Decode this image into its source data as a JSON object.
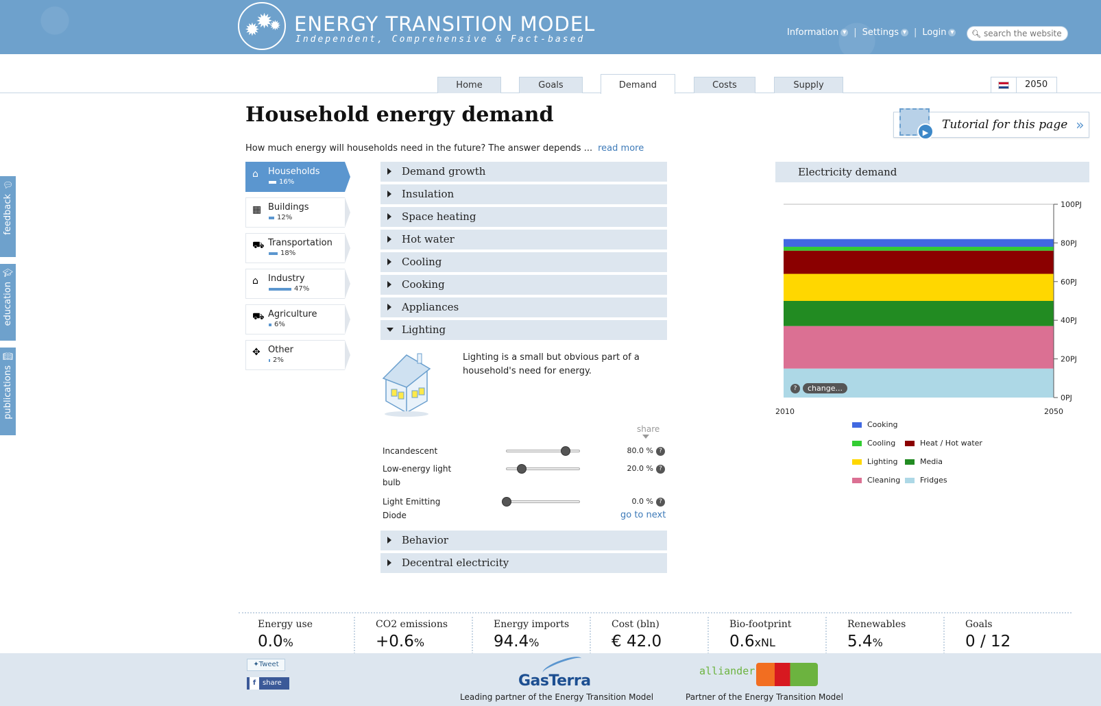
{
  "header": {
    "logo_title": "ENERGY TRANSITION MODEL",
    "logo_subtitle": "Independent, Comprehensive & Fact-based",
    "nav": {
      "information": "Information",
      "settings": "Settings",
      "login": "Login"
    },
    "search_placeholder": "search the website"
  },
  "tabs": [
    "Home",
    "Goals",
    "Demand",
    "Costs",
    "Supply"
  ],
  "active_tab": "Demand",
  "end_year": "2050",
  "page": {
    "title": "Household energy demand",
    "intro": "How much energy will households need in the future? The answer depends ...",
    "read_more": "read more",
    "tutorial": "Tutorial for this page"
  },
  "side_tabs": [
    "feedback",
    "education",
    "publications"
  ],
  "sectors": [
    {
      "name": "Households",
      "pct": "16%",
      "share": 0.16,
      "icon": "house-icon"
    },
    {
      "name": "Buildings",
      "pct": "12%",
      "share": 0.12,
      "icon": "building-icon"
    },
    {
      "name": "Transportation",
      "pct": "18%",
      "share": 0.18,
      "icon": "car-icon"
    },
    {
      "name": "Industry",
      "pct": "47%",
      "share": 0.47,
      "icon": "factory-icon"
    },
    {
      "name": "Agriculture",
      "pct": "6%",
      "share": 0.06,
      "icon": "tractor-icon"
    },
    {
      "name": "Other",
      "pct": "2%",
      "share": 0.02,
      "icon": "move-icon"
    }
  ],
  "accordion": {
    "top": [
      "Demand growth",
      "Insulation",
      "Space heating",
      "Hot water",
      "Cooling",
      "Cooking",
      "Appliances",
      "Lighting"
    ],
    "bottom": [
      "Behavior",
      "Decentral electricity"
    ],
    "open": "Lighting"
  },
  "lighting": {
    "description": "Lighting is a small but obvious part of a household's need for energy.",
    "share_label": "share",
    "sliders": [
      {
        "label": "Incandescent",
        "value": "80.0 %",
        "fraction": 0.8
      },
      {
        "label": "Low-energy light bulb",
        "value": "20.0 %",
        "fraction": 0.2
      },
      {
        "label": "Light Emitting Diode",
        "value": "0.0 %",
        "fraction": 0.0
      }
    ],
    "go_to_next": "go to next"
  },
  "chart_panel": {
    "title": "Electricity demand",
    "change_label": "change...",
    "help_label": "?"
  },
  "chart_data": {
    "type": "bar",
    "stacked": true,
    "categories": [
      "2050"
    ],
    "x_tick_labels": [
      "2010",
      "2050"
    ],
    "y_tick_labels": [
      "0PJ",
      "20PJ",
      "40PJ",
      "60PJ",
      "80PJ",
      "100PJ"
    ],
    "ylim": [
      0,
      100
    ],
    "series": [
      {
        "name": "Fridges",
        "values": [
          15
        ],
        "color": "#add8e6"
      },
      {
        "name": "Cleaning",
        "values": [
          22
        ],
        "color": "#db7093"
      },
      {
        "name": "Media",
        "values": [
          13
        ],
        "color": "#228b22"
      },
      {
        "name": "Lighting",
        "values": [
          14
        ],
        "color": "#ffd700"
      },
      {
        "name": "Heat / Hot water",
        "values": [
          12
        ],
        "color": "#8b0000"
      },
      {
        "name": "Cooling",
        "values": [
          2
        ],
        "color": "#32cd32"
      },
      {
        "name": "Cooking",
        "values": [
          4
        ],
        "color": "#4169e1"
      }
    ],
    "legend": "bottom"
  },
  "kpis": [
    {
      "label": "Energy use",
      "value": "0.0",
      "unit": "%"
    },
    {
      "label": "CO2 emissions",
      "value": "+0.6",
      "unit": "%"
    },
    {
      "label": "Energy imports",
      "value": "94.4",
      "unit": "%"
    },
    {
      "label": "Cost (bln)",
      "value": "€ 42.0",
      "unit": ""
    },
    {
      "label": "Bio-footprint",
      "value": "0.6",
      "unit": "xNL"
    },
    {
      "label": "Renewables",
      "value": "5.4",
      "unit": "%"
    },
    {
      "label": "Goals",
      "value": "0 / 12",
      "unit": ""
    }
  ],
  "footer": {
    "tweet": "Tweet",
    "share": "share",
    "gasterra": "GasTerra",
    "gasterra_text": "Leading partner of the Energy Transition Model",
    "alliander": "alliander",
    "alliander_text": "Partner of the Energy Transition Model"
  }
}
